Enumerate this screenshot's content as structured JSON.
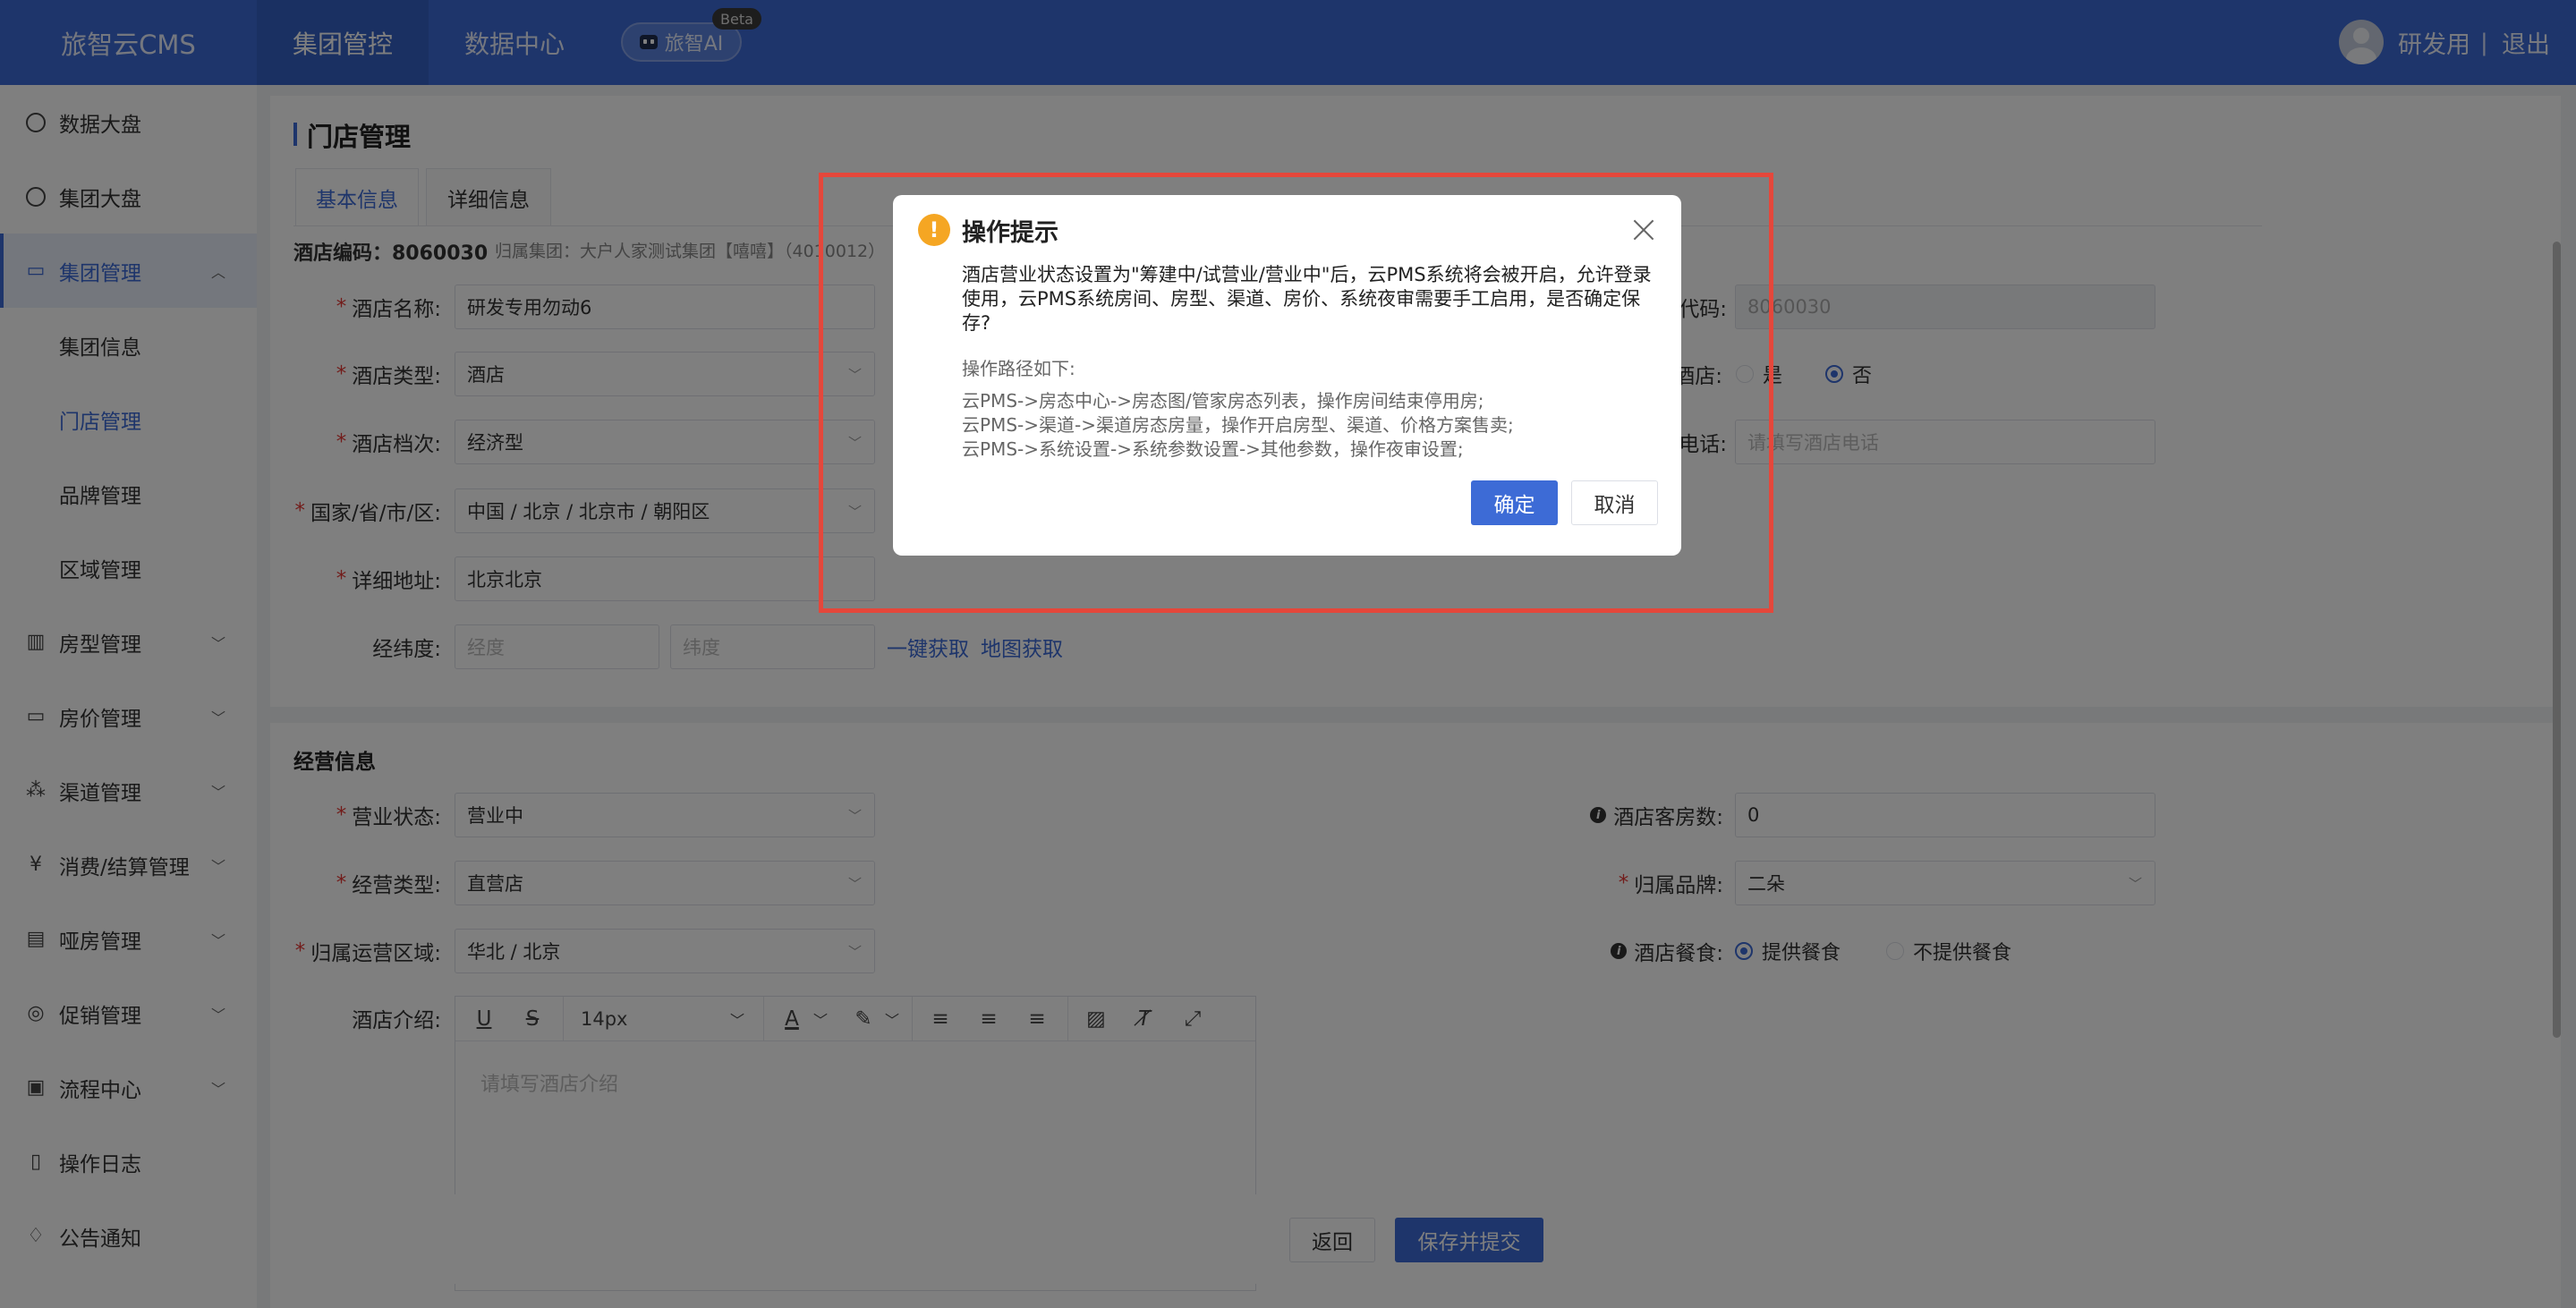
{
  "header": {
    "logo": "旅智云CMS",
    "nav": [
      "集团管控",
      "数据中心"
    ],
    "ai_label": "旅智AI",
    "beta": "Beta",
    "user": "研发用",
    "separator": "|",
    "logout": "退出"
  },
  "sidebar": {
    "items": [
      {
        "label": "数据大盘"
      },
      {
        "label": "集团大盘"
      },
      {
        "label": "集团管理"
      },
      {
        "label": "集团信息"
      },
      {
        "label": "门店管理"
      },
      {
        "label": "品牌管理"
      },
      {
        "label": "区域管理"
      },
      {
        "label": "房型管理"
      },
      {
        "label": "房价管理"
      },
      {
        "label": "渠道管理"
      },
      {
        "label": "消费/结算管理"
      },
      {
        "label": "哑房管理"
      },
      {
        "label": "促销管理"
      },
      {
        "label": "流程中心"
      },
      {
        "label": "操作日志"
      },
      {
        "label": "公告通知"
      }
    ]
  },
  "page": {
    "title": "门店管理",
    "tabs": [
      "基本信息",
      "详细信息"
    ],
    "hotel_code": "酒店编码：8060030",
    "group": "归属集团：大户人家测试集团【嘻嘻】（4010012）"
  },
  "basic": {
    "name_label": "酒店名称:",
    "name_value": "研发专用勿动6",
    "type_label": "酒店类型:",
    "type_value": "酒店",
    "grade_label": "酒店档次:",
    "grade_value": "经济型",
    "region_label": "国家/省/市/区:",
    "region_value": "中国 / 北京 / 北京市 / 朝阳区",
    "address_label": "详细地址:",
    "address_value": "北京北京",
    "latlng_label": "经纬度:",
    "lng_placeholder": "经度",
    "lat_placeholder": "纬度",
    "auto_get": "一键获取",
    "map_get": "地图获取",
    "code_label": "代码:",
    "code_value": "8060030",
    "store_label": "酒店:",
    "yes": "是",
    "no": "否",
    "phone_label": "电话:",
    "phone_placeholder": "请填写酒店电话"
  },
  "ops": {
    "section": "经营信息",
    "status_label": "营业状态:",
    "status_value": "营业中",
    "optype_label": "经营类型:",
    "optype_value": "直营店",
    "area_label": "归属运营区域:",
    "area_value": "华北 / 北京",
    "intro_label": "酒店介绍:",
    "rooms_label": "酒店客房数:",
    "rooms_value": "0",
    "brand_label": "归属品牌:",
    "brand_value": "二朵",
    "meal_label": "酒店餐食:",
    "meal_yes": "提供餐食",
    "meal_no": "不提供餐食"
  },
  "editor": {
    "font_size": "14px",
    "placeholder": "请填写酒店介绍"
  },
  "footer": {
    "back": "返回",
    "submit": "保存并提交"
  },
  "modal": {
    "title": "操作提示",
    "message": "酒店营业状态设置为\"筹建中/试营业/营业中\"后，云PMS系统将会被开启，允许登录使用，云PMS系统房间、房型、渠道、房价、系统夜审需要手工启用，是否确定保存?",
    "path_title": "操作路径如下:",
    "paths": [
      "云PMS->房态中心->房态图/管家房态列表，操作房间结束停用房;",
      "云PMS->渠道->渠道房态房量，操作开启房型、渠道、价格方案售卖;",
      "云PMS->系统设置->系统参数设置->其他参数，操作夜审设置;"
    ],
    "confirm": "确定",
    "cancel": "取消"
  },
  "colors": {
    "primary": "#3d6bd6",
    "warning": "#f5a623",
    "highlight": "#e5473b"
  }
}
